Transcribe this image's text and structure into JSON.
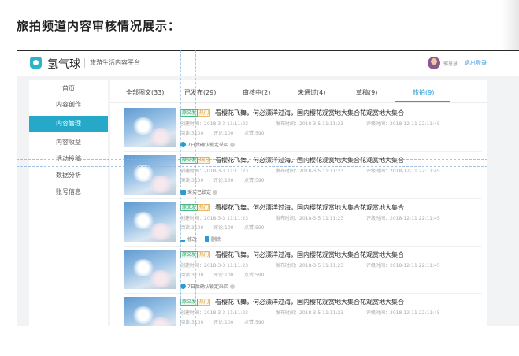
{
  "page_heading": "旅拍频道内容审核情况展示：",
  "topbar": {
    "brand": "氢气球",
    "subtitle": "旅游生活内容平台",
    "user_name": "郭慧慧",
    "logout_label": "退出登录"
  },
  "sidebar": {
    "items": [
      {
        "label": "首页",
        "active": false
      },
      {
        "label": "内容创作",
        "active": false
      },
      {
        "label": "内容管理",
        "active": true
      },
      {
        "label": "内容收益",
        "active": false
      },
      {
        "label": "活动投稿",
        "active": false
      },
      {
        "label": "数据分析",
        "active": false
      },
      {
        "label": "账号信息",
        "active": false
      }
    ]
  },
  "tabs": [
    {
      "label": "全部图文(33)",
      "active": false
    },
    {
      "label": "已发布(29)",
      "active": false
    },
    {
      "label": "审核中(2)",
      "active": false
    },
    {
      "label": "未通过(4)",
      "active": false
    },
    {
      "label": "草稿(9)",
      "active": false
    },
    {
      "label": "旅拍(9)",
      "active": true
    }
  ],
  "articles": [
    {
      "badge_original": "原文发",
      "badge_hot": "热门",
      "title": "看樱花飞舞，何必漂洋过海，国内樱花观赏地大集合花观赏地大集合",
      "created": "创建时间：2018-3-3 11:11:23",
      "published": "发布时间：2018-3-5 11:11:23",
      "reviewed": "评级时间：2018-12-11 22:11:45",
      "reads": "阅读:3100",
      "comments": "评论:100",
      "likes": "点赞:590",
      "status": "7日后确认锁定采买",
      "status_type": "pending"
    },
    {
      "badge_original": "原文发",
      "badge_hot": "热门",
      "title": "看樱花飞舞，何必漂洋过海，国内樱花观赏地大集合花观赏地大集合",
      "created": "创建时间：2018-3-3 11:11:23",
      "published": "发布时间：2018-3-5 11:11:23",
      "reviewed": "评级时间：2018-12-11 22:11:45",
      "reads": "阅读:3100",
      "comments": "评论:100",
      "likes": "点赞:590",
      "status": "采买已锁定",
      "status_type": "locked"
    },
    {
      "badge_original": "原文发",
      "badge_hot": "热门",
      "title": "看樱花飞舞，何必漂洋过海，国内樱花观赏地大集合花观赏地大集合",
      "created": "创建时间：2018-3-3 11:11:23",
      "published": "发布时间：2018-3-5 11:11:23",
      "reviewed": "评级时间：2018-12-11 22:11:45",
      "reads": "阅读:3100",
      "comments": "评论:100",
      "likes": "点赞:590",
      "edit_label": "修改",
      "delete_label": "删除",
      "status_type": "actions"
    },
    {
      "badge_original": "原文发",
      "badge_hot": "热门",
      "title": "看樱花飞舞，何必漂洋过海，国内樱花观赏地大集合花观赏地大集合",
      "created": "创建时间：2018-3-3 11:11:23",
      "published": "发布时间：2018-3-5 11:11:23",
      "reviewed": "评级时间：2018-12-11 22:11:45",
      "reads": "阅读:3100",
      "comments": "评论:100",
      "likes": "点赞:590",
      "status": "7日后确认锁定采买",
      "status_type": "pending"
    },
    {
      "badge_original": "原文发",
      "badge_hot": "热门",
      "title": "看樱花飞舞，何必漂洋过海，国内樱花观赏地大集合花观赏地大集合",
      "created": "创建时间：2018-3-3 11:11:23",
      "published": "发布时间：2018-3-5 11:11:23",
      "reviewed": "评级时间：2018-12-11 22:11:45",
      "reads": "阅读:3100",
      "comments": "评论:100",
      "likes": "点赞:590",
      "status_type": "none"
    }
  ],
  "colors": {
    "accent": "#26a9c9",
    "link": "#2a9bd6",
    "badge_original": "#2ba56b",
    "badge_hot": "#d99a2b"
  }
}
